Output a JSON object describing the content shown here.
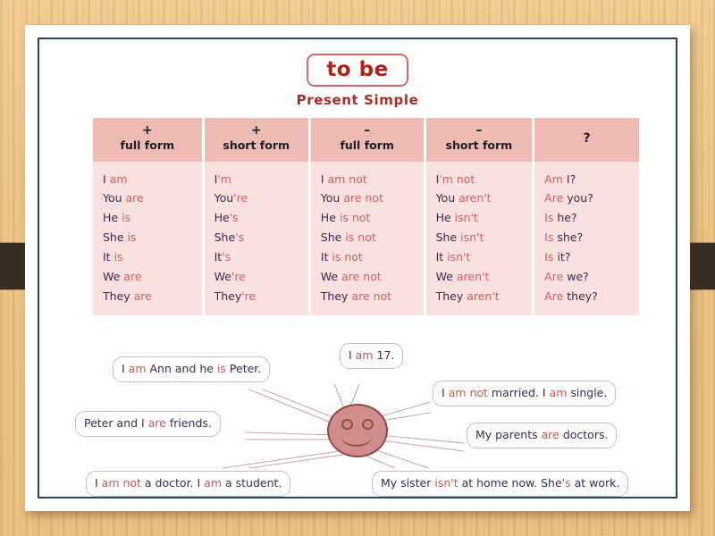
{
  "background": {
    "surface": "wood-desk",
    "wood_color": "#eabf7f",
    "band_color": "#3a2e22"
  },
  "card": {
    "border_color": "#2d4362",
    "background": "#ffffff"
  },
  "title": {
    "box_label": "to be",
    "subtitle": "Present Simple",
    "box_border_color": "#c96b64",
    "text_color": "#b02318"
  },
  "table": {
    "header_bg": "#eebab4",
    "cell_bg": "#f8e1de",
    "pronoun_color": "#3a2a4e",
    "verb_color": "#d05f63",
    "columns": [
      {
        "sign": "+",
        "label": "full form"
      },
      {
        "sign": "+",
        "label": "short form"
      },
      {
        "sign": "–",
        "label": "full form"
      },
      {
        "sign": "–",
        "label": "short form"
      },
      {
        "sign": "?",
        "label": ""
      }
    ],
    "rows": [
      {
        "pos_full": {
          "pronoun": "I",
          "verb": "am"
        },
        "pos_short": {
          "pronoun": "I",
          "verb": "'m"
        },
        "neg_full": {
          "pronoun": "I",
          "verb": "am not"
        },
        "neg_short": {
          "pronoun": "I",
          "verb": "'m not"
        },
        "question": {
          "verb": "Am",
          "pronoun": "I?"
        }
      },
      {
        "pos_full": {
          "pronoun": "You",
          "verb": "are"
        },
        "pos_short": {
          "pronoun": "You",
          "verb": "'re"
        },
        "neg_full": {
          "pronoun": "You",
          "verb": "are not"
        },
        "neg_short": {
          "pronoun": "You",
          "verb": "aren't"
        },
        "question": {
          "verb": "Are",
          "pronoun": "you?"
        }
      },
      {
        "pos_full": {
          "pronoun": "He",
          "verb": "is"
        },
        "pos_short": {
          "pronoun": "He",
          "verb": "'s"
        },
        "neg_full": {
          "pronoun": "He",
          "verb": "is not"
        },
        "neg_short": {
          "pronoun": "He",
          "verb": "isn't"
        },
        "question": {
          "verb": "Is",
          "pronoun": "he?"
        }
      },
      {
        "pos_full": {
          "pronoun": "She",
          "verb": "is"
        },
        "pos_short": {
          "pronoun": "She",
          "verb": "'s"
        },
        "neg_full": {
          "pronoun": "She",
          "verb": "is not"
        },
        "neg_short": {
          "pronoun": "She",
          "verb": "isn't"
        },
        "question": {
          "verb": "Is",
          "pronoun": "she?"
        }
      },
      {
        "pos_full": {
          "pronoun": "It",
          "verb": "is"
        },
        "pos_short": {
          "pronoun": "It",
          "verb": "'s"
        },
        "neg_full": {
          "pronoun": "It",
          "verb": "is not"
        },
        "neg_short": {
          "pronoun": "It",
          "verb": "isn't"
        },
        "question": {
          "verb": "Is",
          "pronoun": "it?"
        }
      },
      {
        "pos_full": {
          "pronoun": "We",
          "verb": "are"
        },
        "pos_short": {
          "pronoun": "We",
          "verb": "'re"
        },
        "neg_full": {
          "pronoun": "We",
          "verb": "are not"
        },
        "neg_short": {
          "pronoun": "We",
          "verb": "aren't"
        },
        "question": {
          "verb": "Are",
          "pronoun": "we?"
        }
      },
      {
        "pos_full": {
          "pronoun": "They",
          "verb": "are"
        },
        "pos_short": {
          "pronoun": "They",
          "verb": "'re"
        },
        "neg_full": {
          "pronoun": "They",
          "verb": "are not"
        },
        "neg_short": {
          "pronoun": "They",
          "verb": "aren't"
        },
        "question": {
          "verb": "Are",
          "pronoun": "they?"
        }
      }
    ]
  },
  "diagram": {
    "face": {
      "fill": "#d18d8d",
      "stroke": "#8d4a46",
      "expression": "smiling-face"
    },
    "bubble_border_color": "#d8b6b4",
    "bubbles": [
      {
        "id": "b1",
        "parts": [
          {
            "t": "I ",
            "k": "p"
          },
          {
            "t": "am",
            "k": "v"
          },
          {
            "t": " Ann and he ",
            "k": "p"
          },
          {
            "t": "is",
            "k": "v"
          },
          {
            "t": " Peter.",
            "k": "p"
          }
        ]
      },
      {
        "id": "b2",
        "parts": [
          {
            "t": "I ",
            "k": "p"
          },
          {
            "t": "am",
            "k": "v"
          },
          {
            "t": " 17.",
            "k": "p"
          }
        ]
      },
      {
        "id": "b3",
        "parts": [
          {
            "t": "I ",
            "k": "p"
          },
          {
            "t": "am not",
            "k": "v"
          },
          {
            "t": " married. I ",
            "k": "p"
          },
          {
            "t": "am",
            "k": "v"
          },
          {
            "t": " single.",
            "k": "p"
          }
        ]
      },
      {
        "id": "b4",
        "parts": [
          {
            "t": "Peter and I ",
            "k": "p"
          },
          {
            "t": "are",
            "k": "v"
          },
          {
            "t": " friends.",
            "k": "p"
          }
        ]
      },
      {
        "id": "b5",
        "parts": [
          {
            "t": "My parents ",
            "k": "p"
          },
          {
            "t": "are",
            "k": "v"
          },
          {
            "t": " doctors.",
            "k": "p"
          }
        ]
      },
      {
        "id": "b6",
        "parts": [
          {
            "t": "I ",
            "k": "p"
          },
          {
            "t": "am not",
            "k": "v"
          },
          {
            "t": " a doctor.  I ",
            "k": "p"
          },
          {
            "t": "am",
            "k": "v"
          },
          {
            "t": " a student.",
            "k": "p"
          }
        ]
      },
      {
        "id": "b7",
        "parts": [
          {
            "t": "My sister ",
            "k": "p"
          },
          {
            "t": "isn't",
            "k": "v"
          },
          {
            "t": " at home now. She",
            "k": "p"
          },
          {
            "t": "'s",
            "k": "v"
          },
          {
            "t": " at work.",
            "k": "p"
          }
        ]
      }
    ]
  }
}
